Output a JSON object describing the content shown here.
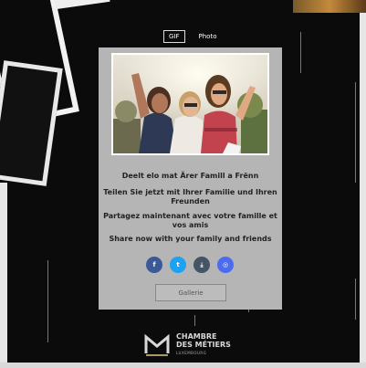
{
  "tabs": [
    {
      "label": "GIF",
      "active": true
    },
    {
      "label": "Photo",
      "active": false
    }
  ],
  "share": {
    "lines": [
      "Deelt elo mat Ärer Famill a Frënn",
      "Teilen Sie jetzt mit Ihrer Familie und Ihren Freunden",
      "Partagez maintenant avec votre famille et vos amis",
      "Share now with your family and friends"
    ]
  },
  "social": [
    {
      "icon": "facebook-icon",
      "glyph": "f",
      "color": "#3b5998"
    },
    {
      "icon": "twitter-icon",
      "glyph": "t",
      "color": "#1da1f2"
    },
    {
      "icon": "download-icon",
      "glyph": "⤓",
      "color": "#445566"
    },
    {
      "icon": "instagram-icon",
      "glyph": "◎",
      "color": "#4b6cf0"
    }
  ],
  "gallery": {
    "label": "Gallerie"
  },
  "logo": {
    "line1": "CHAMBRE",
    "line2": "DES MÉTIERS",
    "line3": "LUXEMBOURG"
  },
  "colors": {
    "panel": "#b5b5b5",
    "background": "#0b0b0b"
  }
}
